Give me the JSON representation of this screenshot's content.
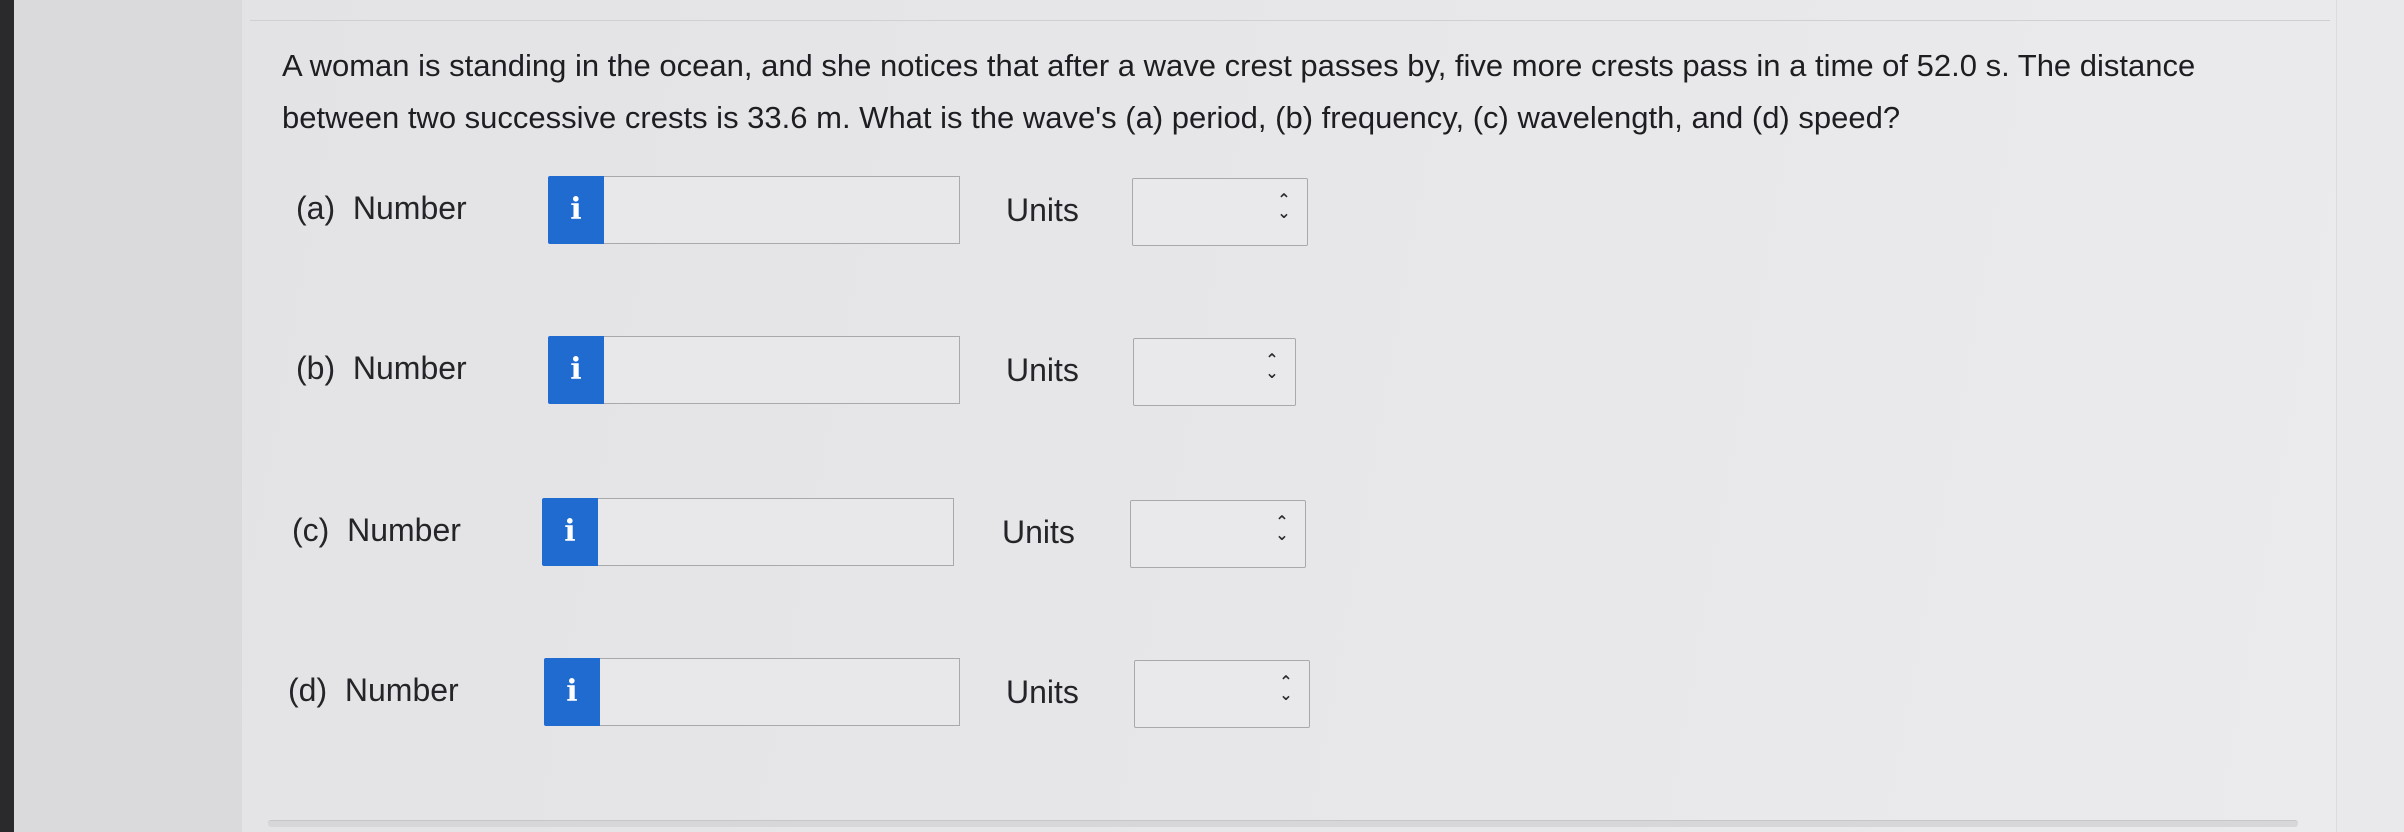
{
  "question": {
    "text": "A woman is standing in the ocean, and she notices that after a wave crest passes by, five more crests pass in a time of 52.0 s. The distance between two successive crests is 33.6 m. What is the wave's (a) period, (b) frequency, (c) wavelength, and (d) speed?"
  },
  "info_glyph": "i",
  "parts": [
    {
      "label": "(a)",
      "number_label": "Number",
      "number_value": "",
      "units_label": "Units",
      "units_value": ""
    },
    {
      "label": "(b)",
      "number_label": "Number",
      "number_value": "",
      "units_label": "Units",
      "units_value": ""
    },
    {
      "label": "(c)",
      "number_label": "Number",
      "number_value": "",
      "units_label": "Units",
      "units_value": ""
    },
    {
      "label": "(d)",
      "number_label": "Number",
      "number_value": "",
      "units_label": "Units",
      "units_value": ""
    }
  ],
  "colors": {
    "info_button": "#1f6bd0",
    "text": "#1e1e22",
    "border": "#a9a9ad"
  },
  "icons": {
    "info": "info-icon",
    "select_arrows": "chevron-up-down-icon"
  }
}
